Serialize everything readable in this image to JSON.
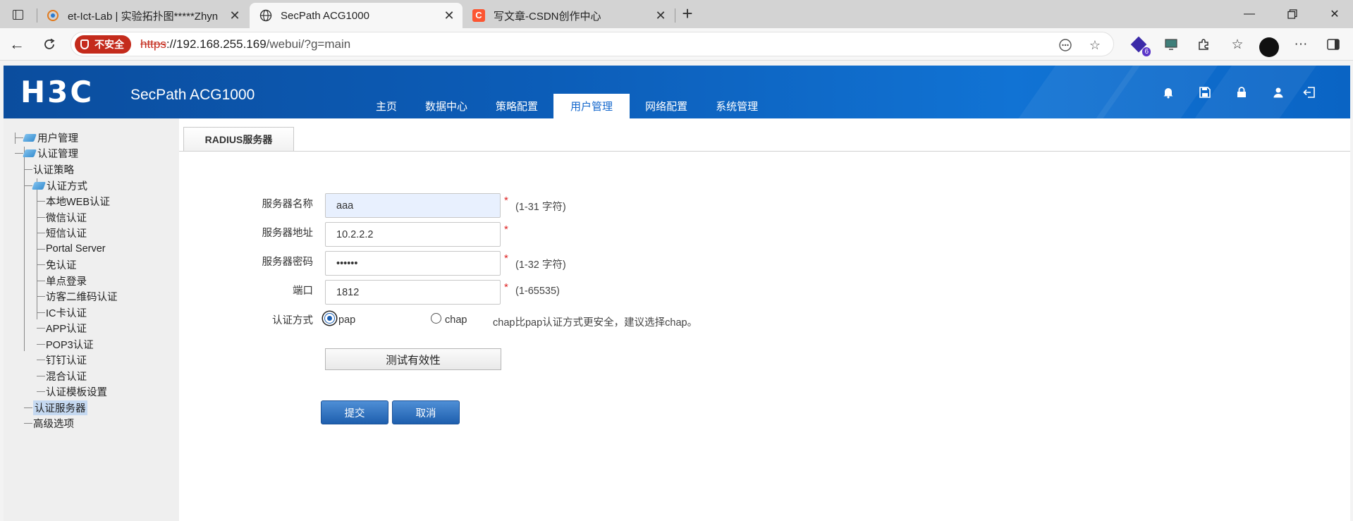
{
  "browser": {
    "tabs": [
      {
        "title": "et-Ict-Lab | 实验拓扑图*****Zhyn",
        "active": false
      },
      {
        "title": "SecPath ACG1000",
        "active": true
      },
      {
        "title": "写文章-CSDN创作中心",
        "active": false
      }
    ],
    "security_label": "不安全",
    "url_scheme": "https",
    "url_host": "://192.168.255.169",
    "url_path": "/webui/?g=main",
    "extension_badge": "6"
  },
  "header": {
    "logo": "H3C",
    "product": "SecPath ACG1000",
    "nav": [
      "主页",
      "数据中心",
      "策略配置",
      "用户管理",
      "网络配置",
      "系统管理"
    ],
    "active_nav": "用户管理",
    "icons": [
      "bell-icon",
      "save-icon",
      "lock-icon",
      "user-icon",
      "logout-icon"
    ]
  },
  "sidebar": {
    "root": "用户管理",
    "auth_mgmt": "认证管理",
    "auth_policy": "认证策略",
    "auth_method": "认证方式",
    "methods": [
      "本地WEB认证",
      "微信认证",
      "短信认证",
      "Portal Server",
      "免认证",
      "单点登录",
      "访客二维码认证",
      "IC卡认证",
      "APP认证",
      "POP3认证",
      "钉钉认证",
      "混合认证",
      "认证模板设置"
    ],
    "auth_server": "认证服务器",
    "advanced": "高级选项"
  },
  "page": {
    "subtab": "RADIUS服务器",
    "form": {
      "name_label": "服务器名称",
      "name_value": "aaa",
      "name_hint": "(1-31 字符)",
      "addr_label": "服务器地址",
      "addr_value": "10.2.2.2",
      "pwd_label": "服务器密码",
      "pwd_value": "••••••",
      "pwd_hint": "(1-32 字符)",
      "port_label": "端口",
      "port_value": "1812",
      "port_hint": "(1-65535)",
      "required_mark": "*",
      "method_label": "认证方式",
      "method_options": [
        "pap",
        "chap"
      ],
      "method_selected": "pap",
      "method_hint": "chap比pap认证方式更安全，建议选择chap。"
    },
    "test_button": "测试有效性",
    "submit_button": "提交",
    "cancel_button": "取消"
  }
}
